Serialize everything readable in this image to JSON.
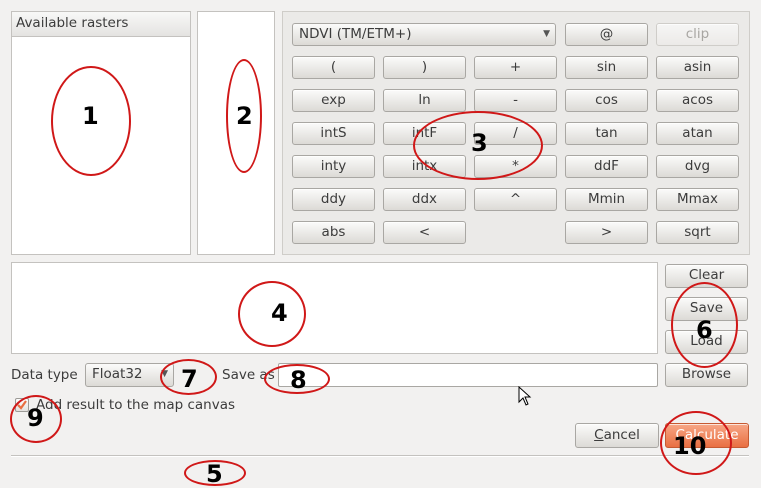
{
  "rasters_panel": {
    "header": "Available rasters"
  },
  "layer_combo": {
    "selected": "NDVI (TM/ETM+)"
  },
  "buttons": {
    "at": "@",
    "clip": "clip",
    "open_paren": "(",
    "close_paren": ")",
    "plus": "+",
    "sin": "sin",
    "asin": "asin",
    "exp": "exp",
    "ln": "ln",
    "minus": "-",
    "cos": "cos",
    "acos": "acos",
    "intS": "intS",
    "intF": "intF",
    "divide": "/",
    "tan": "tan",
    "atan": "atan",
    "inty": "inty",
    "intx": "intx",
    "multiply": "*",
    "ddF": "ddF",
    "dvg": "dvg",
    "ddy": "ddy",
    "ddx": "ddx",
    "power": "^",
    "Mmin": "Mmin",
    "Mmax": "Mmax",
    "abs": "abs",
    "less": "<",
    "greater": ">",
    "sqrt": "sqrt"
  },
  "expression_actions": {
    "clear": "Clear",
    "save": "Save",
    "load": "Load"
  },
  "data_type": {
    "label": "Data type",
    "value": "Float32"
  },
  "save_as": {
    "label": "Save as",
    "value": "",
    "browse": "Browse"
  },
  "add_result": {
    "label": "Add result to the map canvas",
    "checked": true
  },
  "dialog_buttons": {
    "cancel": "Cancel",
    "calculate": "Calculate"
  },
  "annotations": [
    "1",
    "2",
    "3",
    "4",
    "5",
    "6",
    "7",
    "8",
    "9",
    "10"
  ],
  "colors": {
    "annotation": "#d01818",
    "accent": "#e96f42"
  }
}
